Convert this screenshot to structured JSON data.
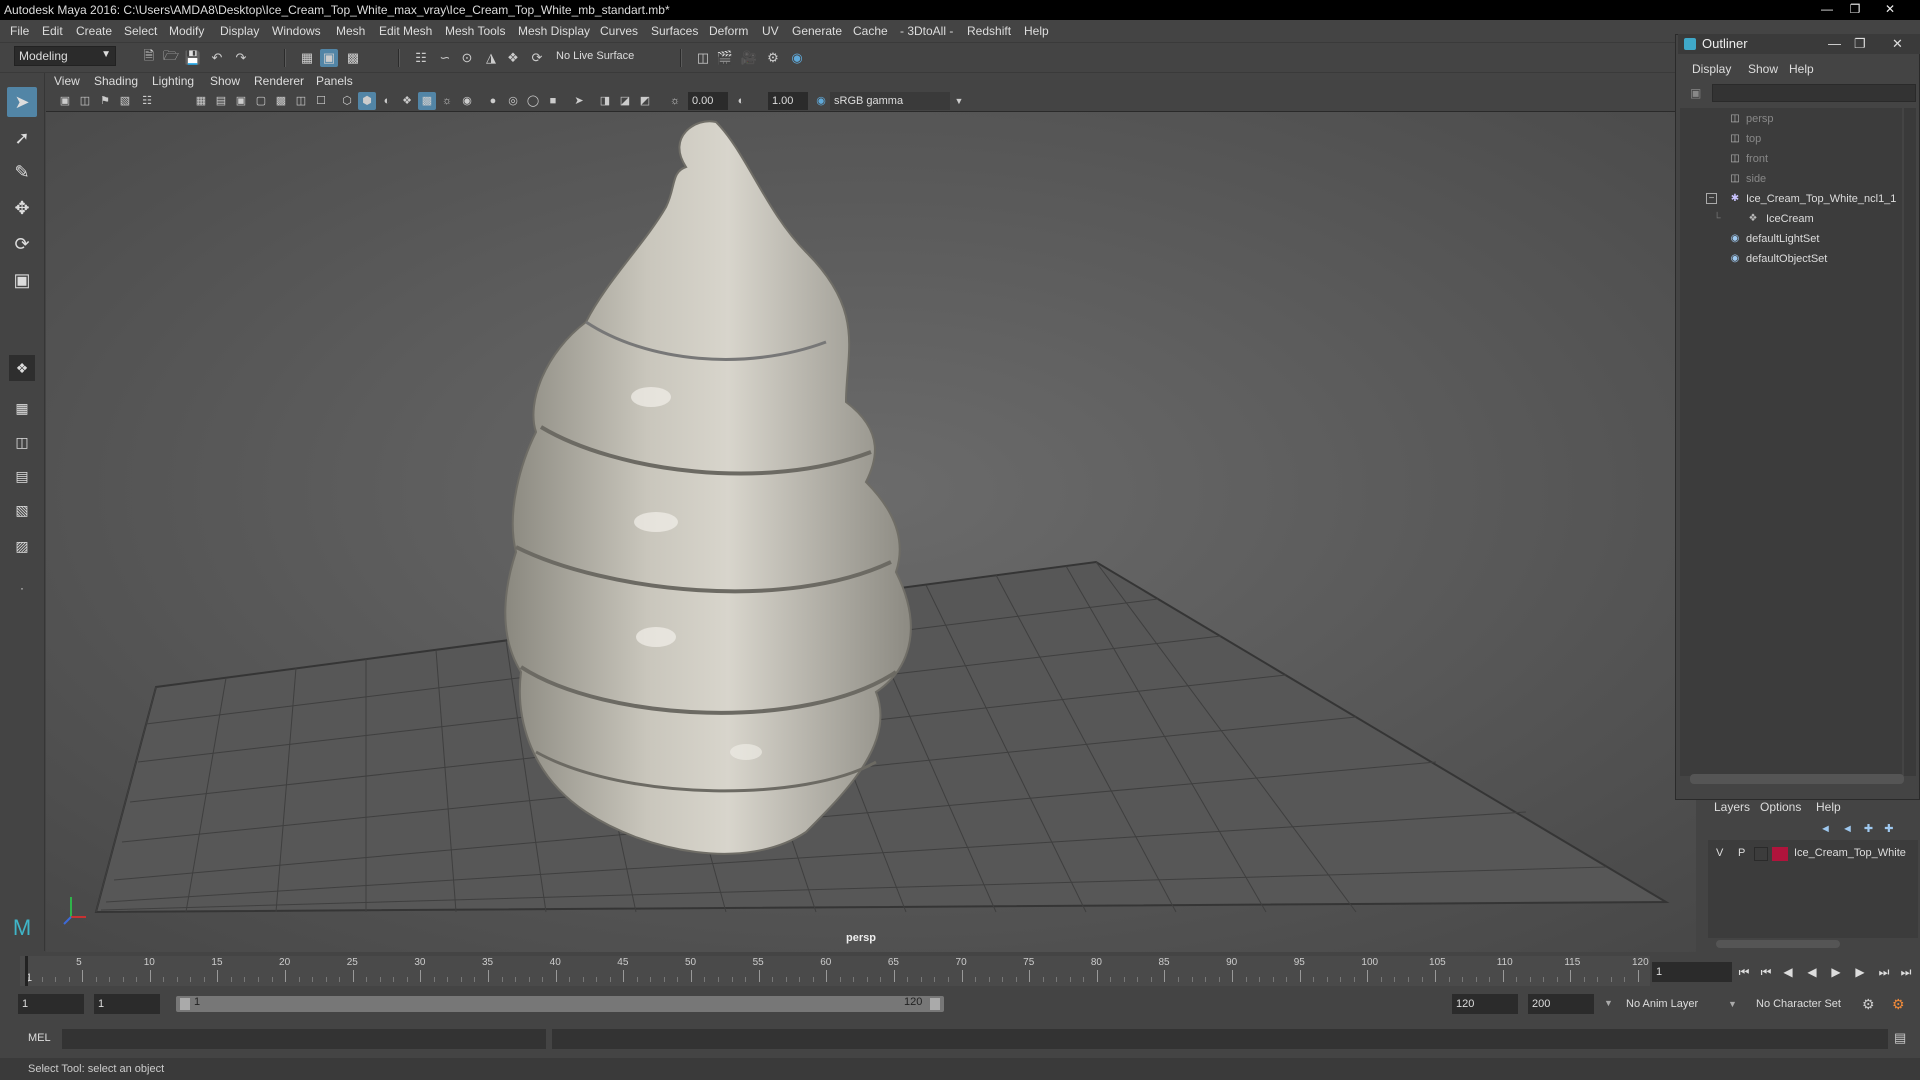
{
  "window": {
    "title": "Autodesk Maya 2016: C:\\Users\\AMDA8\\Desktop\\Ice_Cream_Top_White_max_vray\\Ice_Cream_Top_White_mb_standart.mb*"
  },
  "menubar": {
    "items": [
      "File",
      "Edit",
      "Create",
      "Select",
      "Modify",
      "Display",
      "Windows",
      "Mesh",
      "Edit Mesh",
      "Mesh Tools",
      "Mesh Display",
      "Curves",
      "Surfaces",
      "Deform",
      "UV",
      "Generate",
      "Cache",
      "- 3DtoAll -",
      "Redshift",
      "Help"
    ]
  },
  "statusline": {
    "mode": "Modeling",
    "live_surface": "No Live Surface"
  },
  "panel": {
    "menu": [
      "View",
      "Shading",
      "Lighting",
      "Show",
      "Renderer",
      "Panels"
    ],
    "exposure": "0.00",
    "gamma": "1.00",
    "color_space": "sRGB gamma",
    "camera_label": "persp"
  },
  "outliner": {
    "title": "Outliner",
    "menu": [
      "Display",
      "Show",
      "Help"
    ],
    "items": [
      {
        "label": "persp",
        "icon": "camera-icon",
        "dim": true
      },
      {
        "label": "top",
        "icon": "camera-icon",
        "dim": true
      },
      {
        "label": "front",
        "icon": "camera-icon",
        "dim": true
      },
      {
        "label": "side",
        "icon": "camera-icon",
        "dim": true
      },
      {
        "label": "Ice_Cream_Top_White_ncl1_1",
        "icon": "group-icon",
        "dim": false
      },
      {
        "label": "IceCream",
        "icon": "mesh-icon",
        "dim": false
      },
      {
        "label": "defaultLightSet",
        "icon": "set-icon",
        "dim": false
      },
      {
        "label": "defaultObjectSet",
        "icon": "set-icon",
        "dim": false
      }
    ]
  },
  "layers": {
    "menu": [
      "Layers",
      "Options",
      "Help"
    ],
    "row": {
      "v": "V",
      "p": "P",
      "name": "Ice_Cream_Top_White",
      "color": "#b0143c"
    }
  },
  "timeline": {
    "ticks": [
      "5",
      "10",
      "15",
      "20",
      "25",
      "30",
      "35",
      "40",
      "45",
      "50",
      "55",
      "60",
      "65",
      "70",
      "75",
      "80",
      "85",
      "90",
      "95",
      "100",
      "105",
      "110",
      "115",
      "120"
    ],
    "start_marker": "1",
    "current_frame": "1",
    "range_start": "1",
    "range_start2": "1",
    "slider_start": "1",
    "slider_end": "120",
    "range_end": "120",
    "anim_end": "200",
    "anim_layer": "No Anim Layer",
    "character_set": "No Character Set"
  },
  "command": {
    "lang": "MEL"
  },
  "help": {
    "text": "Select Tool: select an object"
  },
  "colors": {
    "accent": "#5285a6",
    "viewport_bg": "#5d5d5d",
    "grid": "#3e3e3e"
  }
}
